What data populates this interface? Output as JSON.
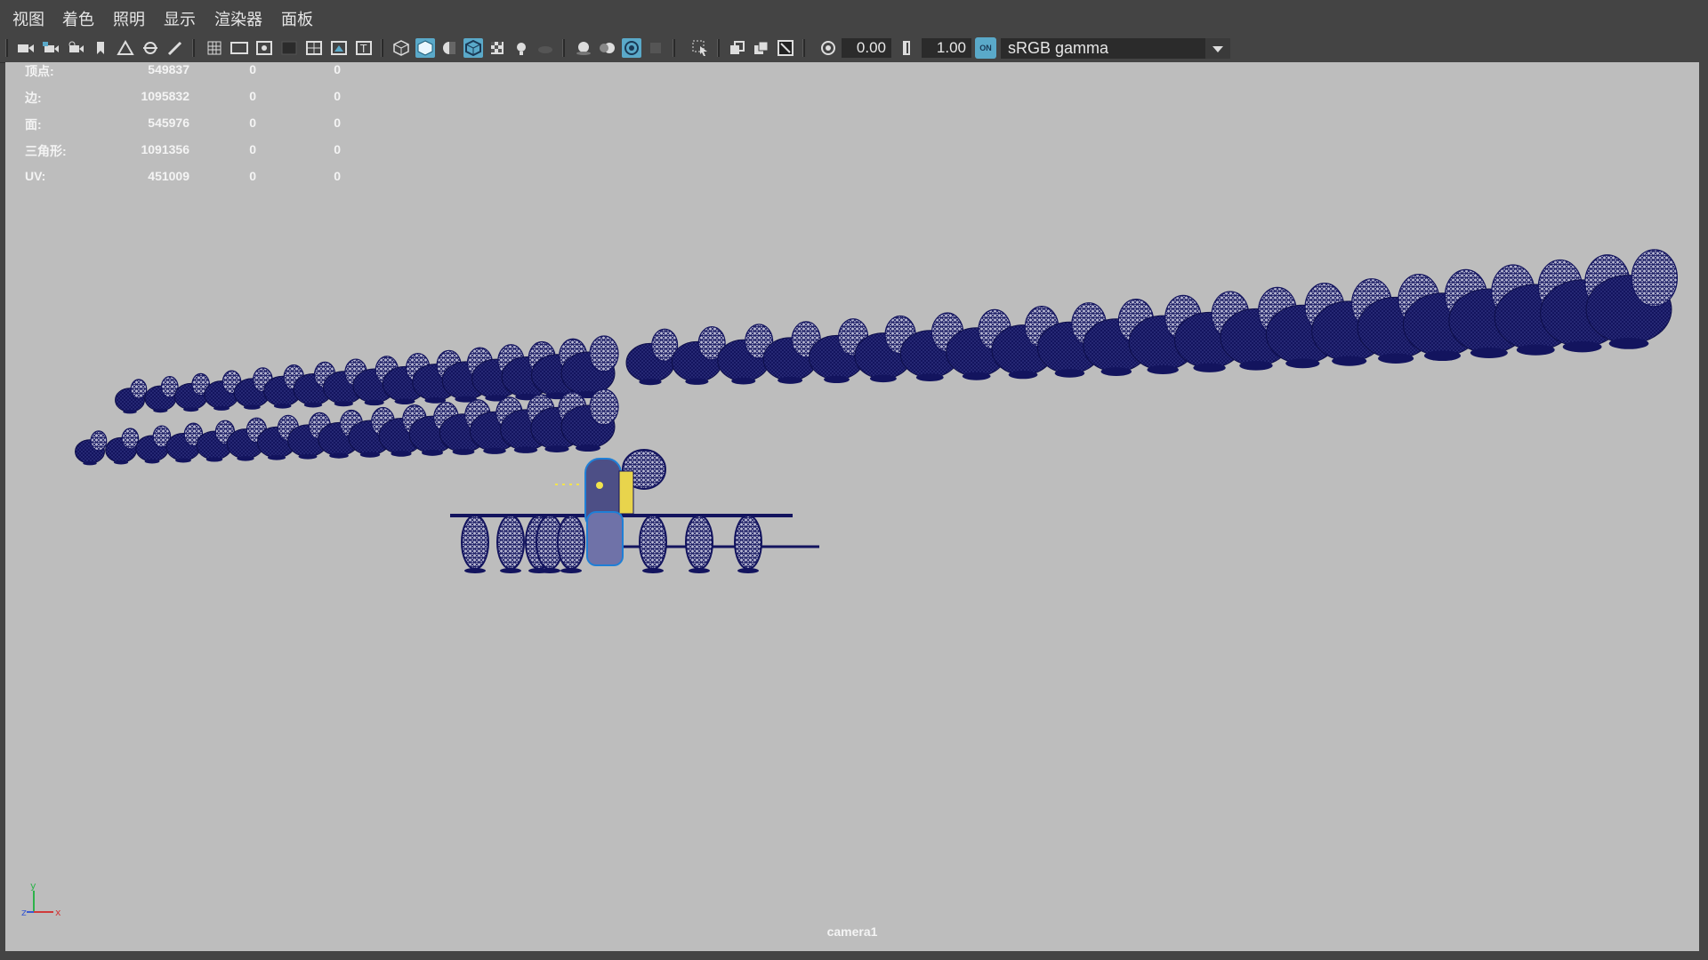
{
  "menubar": {
    "items": [
      "视图",
      "着色",
      "照明",
      "显示",
      "渲染器",
      "面板"
    ]
  },
  "toolbar": {
    "gamma_value": "0.00",
    "exposure_value": "1.00",
    "colorspace": "sRGB gamma",
    "colorspace_badge": "ON"
  },
  "hud": {
    "rows": [
      {
        "label": "顶点:",
        "v1": "549837",
        "v2": "0",
        "v3": "0"
      },
      {
        "label": "边:",
        "v1": "1095832",
        "v2": "0",
        "v3": "0"
      },
      {
        "label": "面:",
        "v1": "545976",
        "v2": "0",
        "v3": "0"
      },
      {
        "label": "三角形:",
        "v1": "1091356",
        "v2": "0",
        "v3": "0"
      },
      {
        "label": "UV:",
        "v1": "451009",
        "v2": "0",
        "v3": "0"
      }
    ]
  },
  "viewport": {
    "camera_name": "camera1",
    "background_color": "#bdbdbd",
    "wireframe_color": "#13145e",
    "axis_labels": {
      "y": "y",
      "z": "z",
      "x": "x"
    }
  },
  "colors": {
    "ui_bg": "#444444",
    "active_icon": "#5aa9c9",
    "field_bg": "#2b2b2b"
  }
}
